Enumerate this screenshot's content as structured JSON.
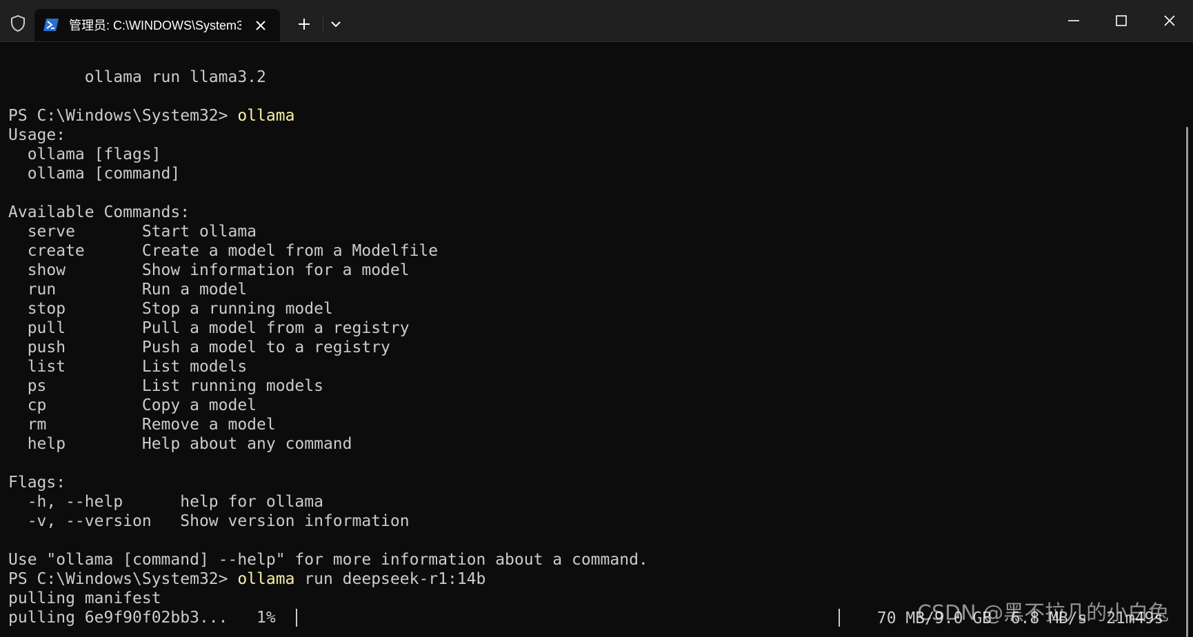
{
  "titlebar": {
    "tab_title": "管理员: C:\\WINDOWS\\System3",
    "icons": {
      "shield": "shield-icon",
      "tab": "powershell-icon",
      "close_tab": "close-icon",
      "new_tab": "plus-icon",
      "dropdown": "chevron-down-icon",
      "minimize": "minimize-icon",
      "maximize": "maximize-icon",
      "close_window": "close-icon"
    }
  },
  "terminal": {
    "lines": [
      {
        "text": "        ollama run llama3.2"
      },
      {
        "text": ""
      },
      {
        "prompt": "PS C:\\Windows\\System32> ",
        "cmd": "ollama",
        "rest": ""
      },
      {
        "text": "Usage:"
      },
      {
        "text": "  ollama [flags]"
      },
      {
        "text": "  ollama [command]"
      },
      {
        "text": ""
      },
      {
        "text": "Available Commands:"
      },
      {
        "text": "  serve       Start ollama"
      },
      {
        "text": "  create      Create a model from a Modelfile"
      },
      {
        "text": "  show        Show information for a model"
      },
      {
        "text": "  run         Run a model"
      },
      {
        "text": "  stop        Stop a running model"
      },
      {
        "text": "  pull        Pull a model from a registry"
      },
      {
        "text": "  push        Push a model to a registry"
      },
      {
        "text": "  list        List models"
      },
      {
        "text": "  ps          List running models"
      },
      {
        "text": "  cp          Copy a model"
      },
      {
        "text": "  rm          Remove a model"
      },
      {
        "text": "  help        Help about any command"
      },
      {
        "text": ""
      },
      {
        "text": "Flags:"
      },
      {
        "text": "  -h, --help      help for ollama"
      },
      {
        "text": "  -v, --version   Show version information"
      },
      {
        "text": ""
      },
      {
        "text": "Use \"ollama [command] --help\" for more information about a command."
      },
      {
        "prompt": "PS C:\\Windows\\System32> ",
        "cmd": "ollama",
        "rest": " run deepseek-r1:14b"
      },
      {
        "text": "pulling manifest"
      },
      {
        "text": "pulling 6e9f90f02bb3...   1% "
      }
    ],
    "progress": {
      "percent": 1,
      "stats": " 70 MB/9.0 GB  6.8 MB/s  21m49s"
    },
    "watermark": "CSDN @黑不拉几的小白兔"
  },
  "colors": {
    "background": "#0c0c0c",
    "titlebar": "#202020",
    "text": "#cccccc",
    "command": "#f9f1a5",
    "ps_icon": "#2a6fd6"
  }
}
